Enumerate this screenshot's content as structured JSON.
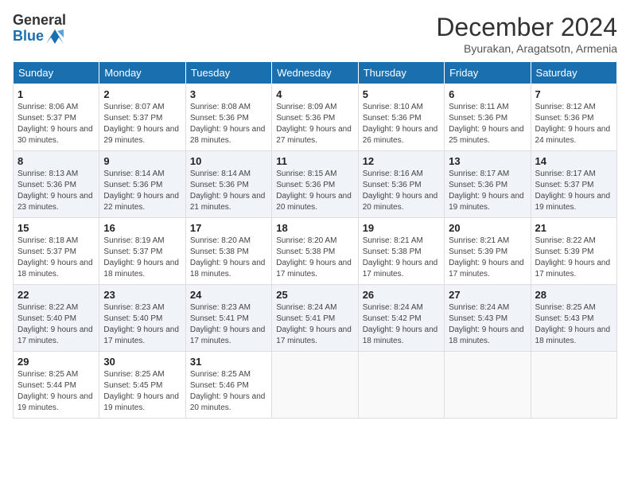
{
  "header": {
    "logo_line1": "General",
    "logo_line2": "Blue",
    "month_year": "December 2024",
    "location": "Byurakan, Aragatsotn, Armenia"
  },
  "weekdays": [
    "Sunday",
    "Monday",
    "Tuesday",
    "Wednesday",
    "Thursday",
    "Friday",
    "Saturday"
  ],
  "weeks": [
    [
      {
        "day": "1",
        "sunrise": "8:06 AM",
        "sunset": "5:37 PM",
        "daylight": "9 hours and 30 minutes."
      },
      {
        "day": "2",
        "sunrise": "8:07 AM",
        "sunset": "5:37 PM",
        "daylight": "9 hours and 29 minutes."
      },
      {
        "day": "3",
        "sunrise": "8:08 AM",
        "sunset": "5:36 PM",
        "daylight": "9 hours and 28 minutes."
      },
      {
        "day": "4",
        "sunrise": "8:09 AM",
        "sunset": "5:36 PM",
        "daylight": "9 hours and 27 minutes."
      },
      {
        "day": "5",
        "sunrise": "8:10 AM",
        "sunset": "5:36 PM",
        "daylight": "9 hours and 26 minutes."
      },
      {
        "day": "6",
        "sunrise": "8:11 AM",
        "sunset": "5:36 PM",
        "daylight": "9 hours and 25 minutes."
      },
      {
        "day": "7",
        "sunrise": "8:12 AM",
        "sunset": "5:36 PM",
        "daylight": "9 hours and 24 minutes."
      }
    ],
    [
      {
        "day": "8",
        "sunrise": "8:13 AM",
        "sunset": "5:36 PM",
        "daylight": "9 hours and 23 minutes."
      },
      {
        "day": "9",
        "sunrise": "8:14 AM",
        "sunset": "5:36 PM",
        "daylight": "9 hours and 22 minutes."
      },
      {
        "day": "10",
        "sunrise": "8:14 AM",
        "sunset": "5:36 PM",
        "daylight": "9 hours and 21 minutes."
      },
      {
        "day": "11",
        "sunrise": "8:15 AM",
        "sunset": "5:36 PM",
        "daylight": "9 hours and 20 minutes."
      },
      {
        "day": "12",
        "sunrise": "8:16 AM",
        "sunset": "5:36 PM",
        "daylight": "9 hours and 20 minutes."
      },
      {
        "day": "13",
        "sunrise": "8:17 AM",
        "sunset": "5:36 PM",
        "daylight": "9 hours and 19 minutes."
      },
      {
        "day": "14",
        "sunrise": "8:17 AM",
        "sunset": "5:37 PM",
        "daylight": "9 hours and 19 minutes."
      }
    ],
    [
      {
        "day": "15",
        "sunrise": "8:18 AM",
        "sunset": "5:37 PM",
        "daylight": "9 hours and 18 minutes."
      },
      {
        "day": "16",
        "sunrise": "8:19 AM",
        "sunset": "5:37 PM",
        "daylight": "9 hours and 18 minutes."
      },
      {
        "day": "17",
        "sunrise": "8:20 AM",
        "sunset": "5:38 PM",
        "daylight": "9 hours and 18 minutes."
      },
      {
        "day": "18",
        "sunrise": "8:20 AM",
        "sunset": "5:38 PM",
        "daylight": "9 hours and 17 minutes."
      },
      {
        "day": "19",
        "sunrise": "8:21 AM",
        "sunset": "5:38 PM",
        "daylight": "9 hours and 17 minutes."
      },
      {
        "day": "20",
        "sunrise": "8:21 AM",
        "sunset": "5:39 PM",
        "daylight": "9 hours and 17 minutes."
      },
      {
        "day": "21",
        "sunrise": "8:22 AM",
        "sunset": "5:39 PM",
        "daylight": "9 hours and 17 minutes."
      }
    ],
    [
      {
        "day": "22",
        "sunrise": "8:22 AM",
        "sunset": "5:40 PM",
        "daylight": "9 hours and 17 minutes."
      },
      {
        "day": "23",
        "sunrise": "8:23 AM",
        "sunset": "5:40 PM",
        "daylight": "9 hours and 17 minutes."
      },
      {
        "day": "24",
        "sunrise": "8:23 AM",
        "sunset": "5:41 PM",
        "daylight": "9 hours and 17 minutes."
      },
      {
        "day": "25",
        "sunrise": "8:24 AM",
        "sunset": "5:41 PM",
        "daylight": "9 hours and 17 minutes."
      },
      {
        "day": "26",
        "sunrise": "8:24 AM",
        "sunset": "5:42 PM",
        "daylight": "9 hours and 18 minutes."
      },
      {
        "day": "27",
        "sunrise": "8:24 AM",
        "sunset": "5:43 PM",
        "daylight": "9 hours and 18 minutes."
      },
      {
        "day": "28",
        "sunrise": "8:25 AM",
        "sunset": "5:43 PM",
        "daylight": "9 hours and 18 minutes."
      }
    ],
    [
      {
        "day": "29",
        "sunrise": "8:25 AM",
        "sunset": "5:44 PM",
        "daylight": "9 hours and 19 minutes."
      },
      {
        "day": "30",
        "sunrise": "8:25 AM",
        "sunset": "5:45 PM",
        "daylight": "9 hours and 19 minutes."
      },
      {
        "day": "31",
        "sunrise": "8:25 AM",
        "sunset": "5:46 PM",
        "daylight": "9 hours and 20 minutes."
      },
      null,
      null,
      null,
      null
    ]
  ],
  "labels": {
    "sunrise": "Sunrise: ",
    "sunset": "Sunset: ",
    "daylight": "Daylight: "
  }
}
